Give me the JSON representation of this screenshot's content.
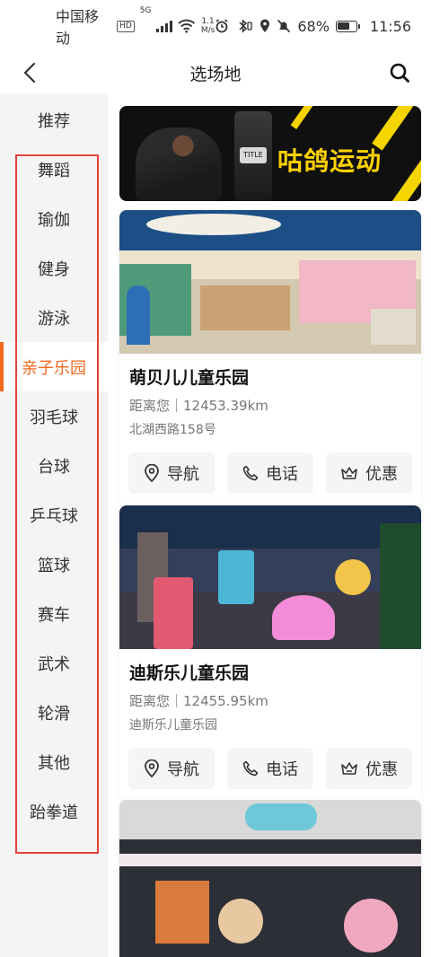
{
  "status": {
    "carrier": "中国移动",
    "hd": "HD",
    "signal": "5G",
    "speed_value": "1.1",
    "speed_unit": "M/s",
    "battery": "68%",
    "battery_level": 0.68,
    "time": "11:56"
  },
  "nav": {
    "title": "选场地"
  },
  "categories": [
    {
      "label": "推荐",
      "active": false
    },
    {
      "label": "舞蹈",
      "active": false
    },
    {
      "label": "瑜伽",
      "active": false
    },
    {
      "label": "健身",
      "active": false
    },
    {
      "label": "游泳",
      "active": false
    },
    {
      "label": "亲子乐园",
      "active": true
    },
    {
      "label": "羽毛球",
      "active": false
    },
    {
      "label": "台球",
      "active": false
    },
    {
      "label": "乒乓球",
      "active": false
    },
    {
      "label": "篮球",
      "active": false
    },
    {
      "label": "赛车",
      "active": false
    },
    {
      "label": "武术",
      "active": false
    },
    {
      "label": "轮滑",
      "active": false
    },
    {
      "label": "其他",
      "active": false
    },
    {
      "label": "跆拳道",
      "active": false
    }
  ],
  "banner": {
    "text": "咕鸽运动",
    "bag_logo": "TITLE"
  },
  "venues": [
    {
      "name": "萌贝儿儿童乐园",
      "distance": "距离您｜12453.39km",
      "address": "北湖西路158号"
    },
    {
      "name": "迪斯乐儿童乐园",
      "distance": "距离您｜12455.95km",
      "address": "迪斯乐儿童乐园"
    }
  ],
  "actions": {
    "navigate": "导航",
    "call": "电话",
    "discount": "优惠"
  },
  "colors": {
    "accent": "#f26a21",
    "highlight_box": "#e0433a"
  }
}
